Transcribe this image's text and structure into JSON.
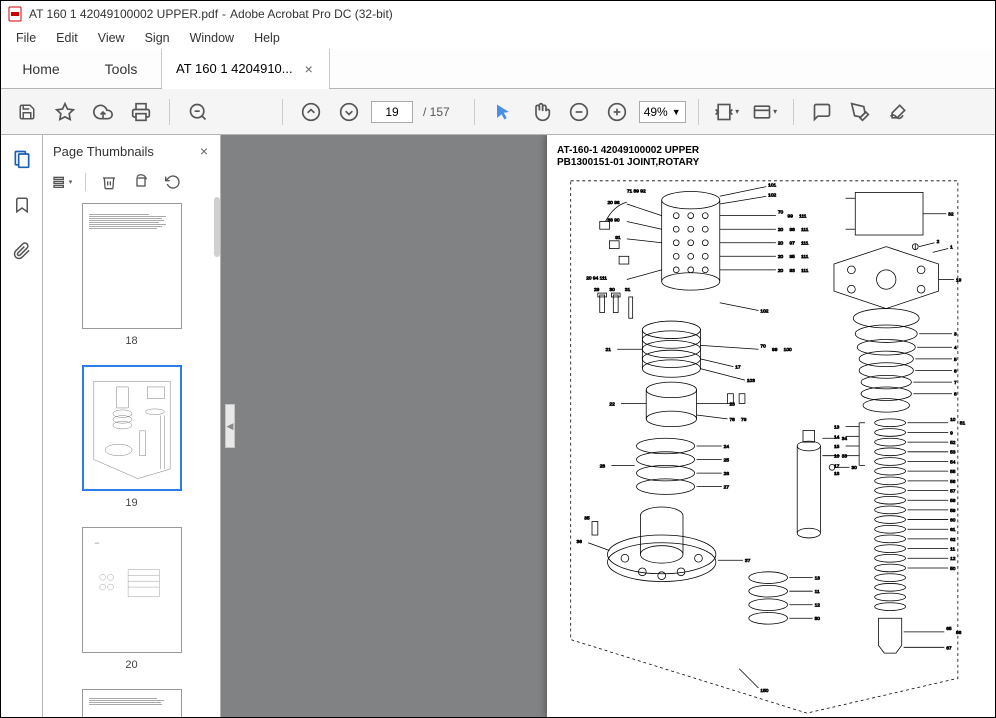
{
  "titlebar": {
    "filename": "AT 160 1 42049100002 UPPER.pdf",
    "appname": "Adobe Acrobat Pro DC (32-bit)"
  },
  "menubar": {
    "items": [
      "File",
      "Edit",
      "View",
      "Sign",
      "Window",
      "Help"
    ]
  },
  "tabs": {
    "home": "Home",
    "tools": "Tools",
    "document": "AT 160 1 4204910..."
  },
  "toolbar": {
    "page_current": "19",
    "page_total": "/ 157",
    "zoom": "49%"
  },
  "thumbs": {
    "title": "Page Thumbnails",
    "items": [
      {
        "label": "18",
        "selected": false
      },
      {
        "label": "19",
        "selected": true
      },
      {
        "label": "20",
        "selected": false
      },
      {
        "label": "",
        "selected": false
      }
    ]
  },
  "document": {
    "title_line1": "AT-160-1 42049100002 UPPER",
    "title_line2": "PB1300151-01 JOINT,ROTARY"
  }
}
